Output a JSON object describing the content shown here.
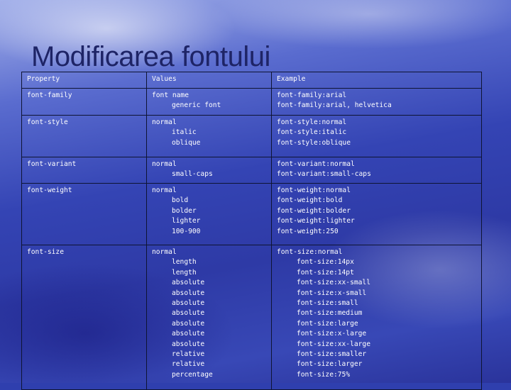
{
  "slide": {
    "title": "Modificarea fontului"
  },
  "table": {
    "headers": [
      "Property",
      "Values",
      "Example"
    ],
    "rows": [
      {
        "property": "font-family",
        "values": [
          "font name",
          "generic font"
        ],
        "examples": [
          "font-family:arial",
          "font-family:arial, helvetica"
        ]
      },
      {
        "property": "font-style",
        "values": [
          "normal",
          "italic",
          "oblique"
        ],
        "examples": [
          "font-style:normal",
          "font-style:italic",
          "font-style:oblique"
        ]
      },
      {
        "property": "font-variant",
        "values": [
          "normal",
          "small-caps"
        ],
        "examples": [
          "font-variant:normal",
          "font-variant:small-caps"
        ]
      },
      {
        "property": "font-weight",
        "values": [
          "normal",
          "bold",
          "bolder",
          "lighter",
          "100-900"
        ],
        "examples": [
          "font-weight:normal",
          "font-weight:bold",
          "font-weight:bolder",
          "font-weight:lighter",
          "font-weight:250"
        ]
      },
      {
        "property": "font-size",
        "values": [
          "normal",
          "length",
          "length",
          "absolute",
          "absolute",
          "absolute",
          "absolute",
          "absolute",
          "absolute",
          "absolute",
          "relative",
          "relative",
          "percentage"
        ],
        "examples": [
          "font-size:normal",
          "font-size:14px",
          "font-size:14pt",
          "font-size:xx-small",
          "font-size:x-small",
          "font-size:small",
          "font-size:medium",
          "font-size:large",
          "font-size:x-large",
          "font-size:xx-large",
          "font-size:smaller",
          "font-size:larger",
          "font-size:75%"
        ]
      }
    ]
  }
}
